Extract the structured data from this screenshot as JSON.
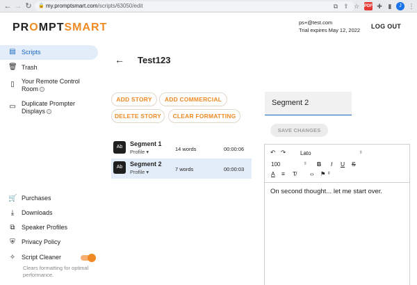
{
  "browser": {
    "url_host": "my.promptsmart.com",
    "url_path": "/scripts/63050/edit",
    "avatar_letter": "J",
    "pdf_label": "PDF"
  },
  "header": {
    "logo_a": "PR",
    "logo_b": "MPT",
    "logo_c": "SMART",
    "email": "ps+@test.com",
    "trial": "Trial expires May 12, 2022",
    "logout": "LOG OUT"
  },
  "sidebar": {
    "items": [
      {
        "label": "Scripts",
        "icon": "document-icon"
      },
      {
        "label": "Trash",
        "icon": "trash-icon"
      },
      {
        "label": "Your Remote Control",
        "label2": "Room",
        "icon": "remote-icon"
      },
      {
        "label": "Duplicate Prompter",
        "label2": "Displays",
        "icon": "monitor-icon"
      }
    ],
    "bottom": [
      {
        "label": "Purchases",
        "icon": "cart-icon"
      },
      {
        "label": "Downloads",
        "icon": "download-icon"
      },
      {
        "label": "Speaker Profiles",
        "icon": "speaker-profiles-icon"
      },
      {
        "label": "Privacy Policy",
        "icon": "shield-icon"
      },
      {
        "label": "Script Cleaner",
        "icon": "clean-icon"
      }
    ],
    "cleaner_note": "Clears formatting for optimal performance.",
    "cleaner_on": true
  },
  "main": {
    "title": "Test123",
    "buttons": {
      "add_story": "ADD STORY",
      "add_commercial": "ADD COMMERCIAL",
      "delete_story": "DELETE STORY",
      "clear_formatting": "CLEAR FORMATTING"
    },
    "segments": [
      {
        "badge": "Ab",
        "name": "Segment 1",
        "profile": "Profile ▾",
        "words": "14 words",
        "duration": "00:00:06",
        "selected": false
      },
      {
        "badge": "Ab",
        "name": "Segment 2",
        "profile": "Profile ▾",
        "words": "7 words",
        "duration": "00:00:03",
        "selected": true
      }
    ]
  },
  "editor_panel": {
    "segment_name": "Segment 2",
    "save_label": "SAVE CHANGES",
    "font": "Lato",
    "size": "100",
    "bold": "B",
    "italic": "I",
    "underline": "U",
    "strike": "S",
    "content": "On second thought... let me start over."
  },
  "colors": {
    "accent": "#f08a24",
    "active_blue": "#1565c0",
    "selected_bg": "#e3edf9"
  }
}
